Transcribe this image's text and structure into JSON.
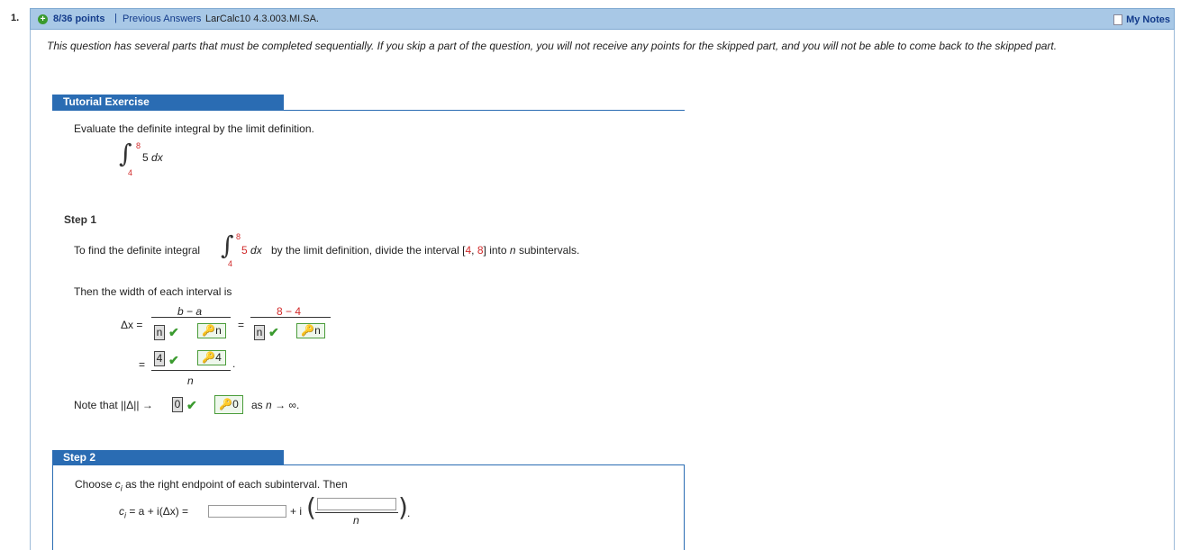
{
  "question": {
    "number": "1.",
    "points": "8/36 points",
    "separator": "|",
    "previous_answers": "Previous Answers",
    "code": "LarCalc10 4.3.003.MI.SA.",
    "my_notes": "My Notes"
  },
  "intro": "This question has several parts that must be completed sequentially. If you skip a part of the question, you will not receive any points for the skipped part, and you will not be able to come back to the skipped part.",
  "tutorial": {
    "header": "Tutorial Exercise",
    "prompt": "Evaluate the definite integral by the limit definition.",
    "integral": {
      "upper": "8",
      "lower": "4",
      "integrand": "5",
      "dx": "dx"
    }
  },
  "step1": {
    "label": "Step 1",
    "sentence_a": "To find the definite integral",
    "sentence_b": "5",
    "sentence_dx": "dx",
    "sentence_c": "by the limit definition, divide the interval",
    "interval_open": "[",
    "interval_a": "4",
    "interval_comma": ",",
    "interval_b": "8",
    "interval_close": "]",
    "sentence_d": "into",
    "n": "n",
    "sentence_e": "subintervals.",
    "width_text": "Then the width of each interval is",
    "delta_x": "Δx =",
    "b_minus_a": "b − a",
    "eight_minus_four": "8 − 4",
    "equals": "=",
    "ans_n1": "n",
    "key_n1": "n",
    "ans_n2": "n",
    "key_n2": "n",
    "ans_4": "4",
    "key_4": "4",
    "period": ".",
    "denom_n": "n",
    "note_a": "Note that",
    "norm": "||Δ||",
    "arrow": "→",
    "ans_0": "0",
    "key_0": "0",
    "note_b": "as",
    "note_n": "n",
    "note_c": "→ ∞."
  },
  "step2": {
    "label": "Step 2",
    "sentence_a": "Choose",
    "ci": "c",
    "ci_sub": "i",
    "sentence_b": "as the right endpoint of each subinterval. Then",
    "formula_left": "= a + i(Δx) =",
    "plus_i": "+ i",
    "denom_n": "n",
    "period": "."
  },
  "colors": {
    "header_bar": "#a8c8e6",
    "tutorial_blue": "#2a6cb3",
    "red": "#d12a2a",
    "check_green": "#3a9a2e"
  }
}
